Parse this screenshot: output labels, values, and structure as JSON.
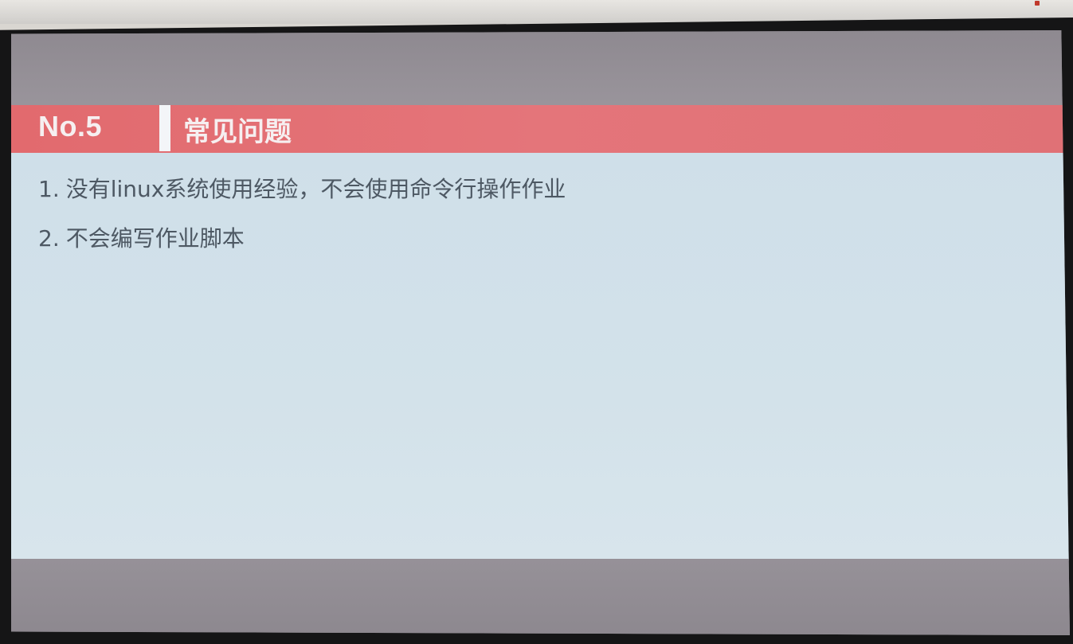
{
  "slide": {
    "number_label": "No.5",
    "title": "常见问题",
    "items": [
      {
        "num": "1.",
        "text": "没有linux系统使用经验，不会使用命令行操作作业"
      },
      {
        "num": "2.",
        "text": "不会编写作业脚本"
      }
    ]
  },
  "colors": {
    "title_bar": "#e26a6e",
    "content_bg": "#d1e0e9",
    "bezel": "#151516",
    "text": "#4d5863"
  }
}
